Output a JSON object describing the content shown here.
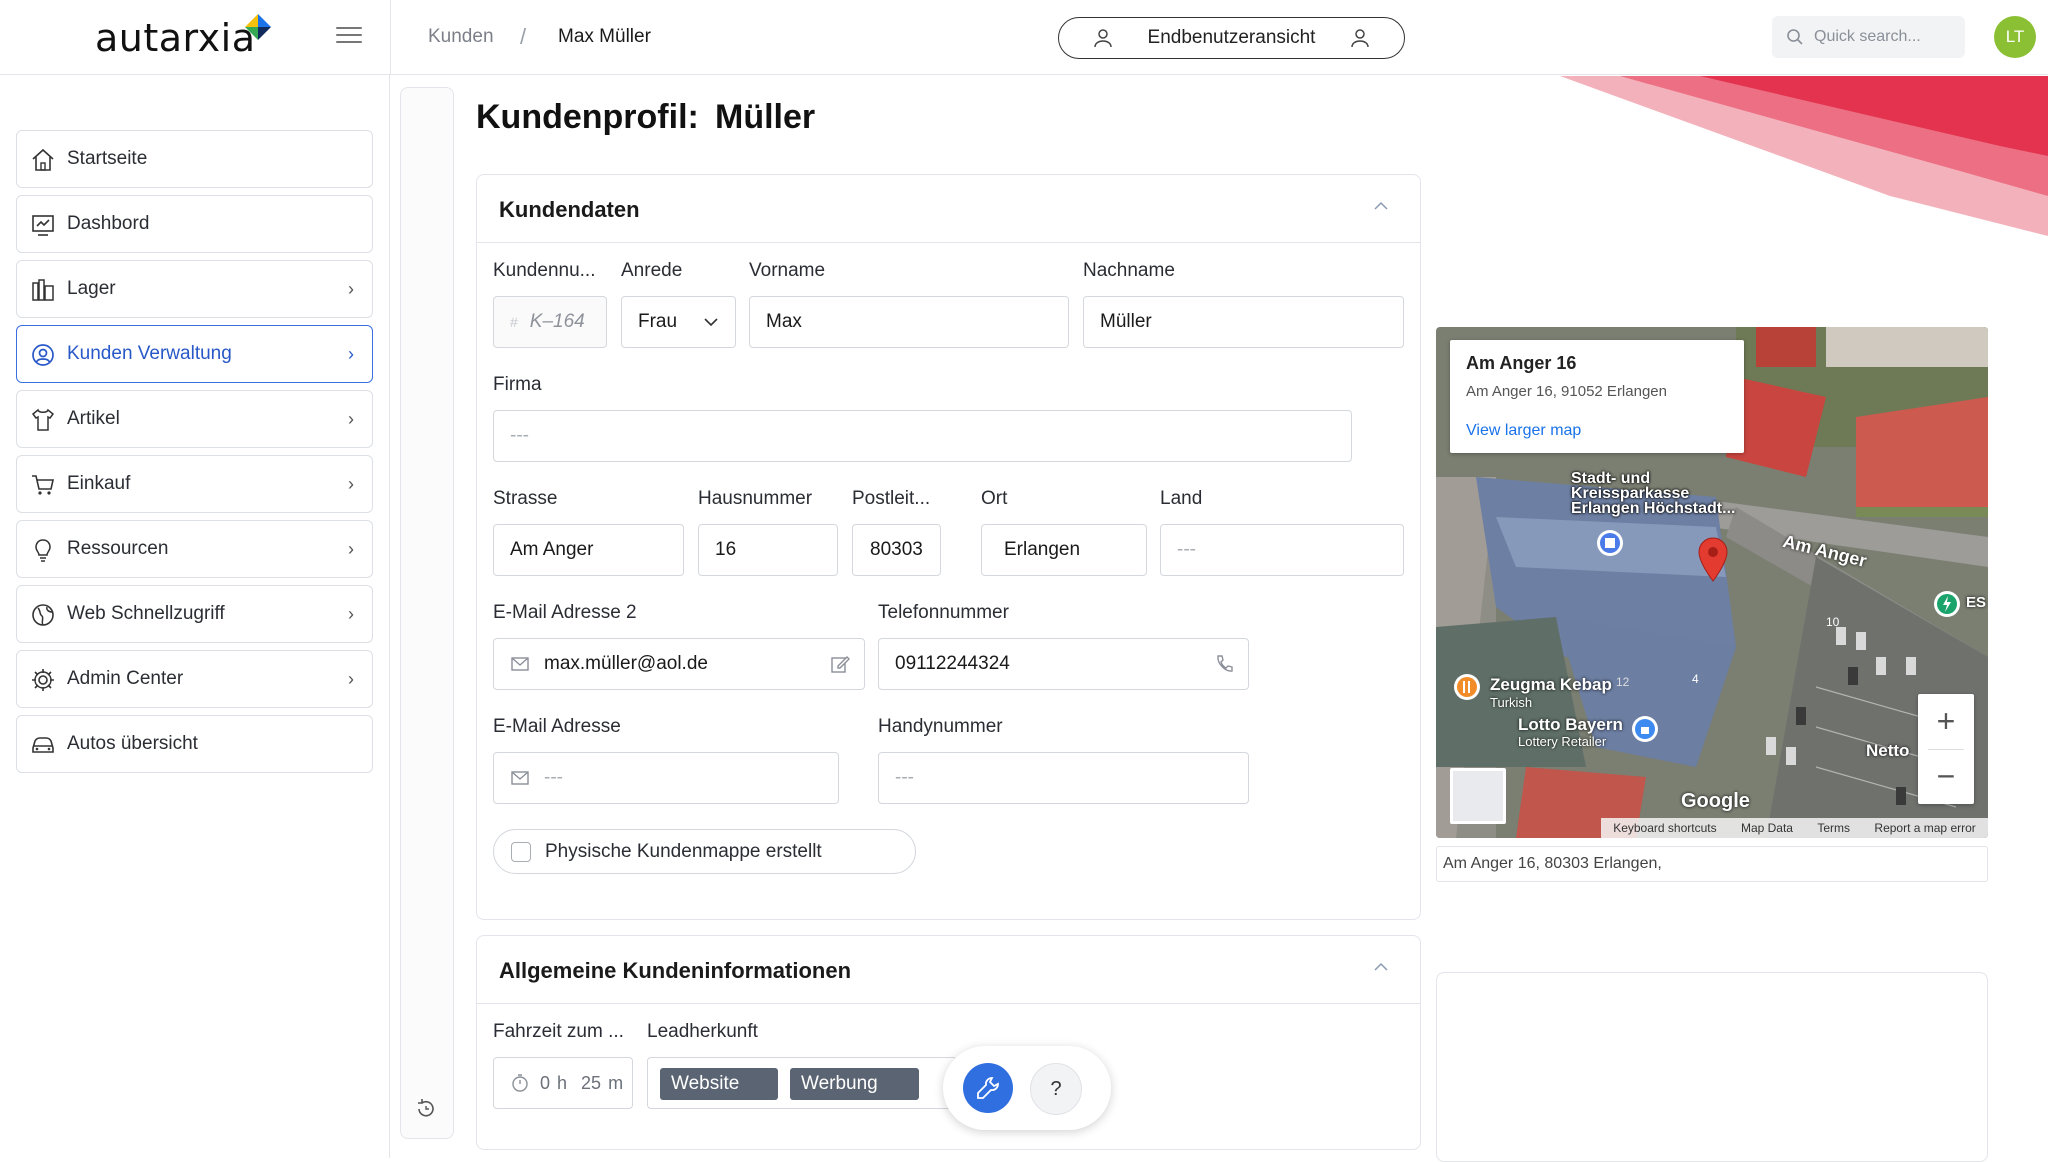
{
  "brand": {
    "name": "autarxia",
    "accent": "#3b6fe0"
  },
  "breadcrumb": {
    "items": [
      "Kunden",
      "Max Müller"
    ],
    "separator": "/"
  },
  "header": {
    "enduser_view_label": "Endbenutzeransicht",
    "search_placeholder": "Quick search...",
    "avatar_initials": "LT"
  },
  "sidebar": {
    "items": [
      {
        "label": "Startseite",
        "icon": "home-icon",
        "chevron": false
      },
      {
        "label": "Dashbord",
        "icon": "dashboard-icon",
        "chevron": false
      },
      {
        "label": "Lager",
        "icon": "warehouse-icon",
        "chevron": true
      },
      {
        "label": "Kunden Verwaltung",
        "icon": "user-circle-icon",
        "chevron": true,
        "active": true
      },
      {
        "label": "Artikel",
        "icon": "shirt-icon",
        "chevron": true
      },
      {
        "label": "Einkauf",
        "icon": "cart-icon",
        "chevron": true
      },
      {
        "label": "Ressourcen",
        "icon": "lightbulb-icon",
        "chevron": true
      },
      {
        "label": "Web Schnellzugriff",
        "icon": "globe-icon",
        "chevron": true
      },
      {
        "label": "Admin Center",
        "icon": "gear-icon",
        "chevron": true
      },
      {
        "label": "Autos übersicht",
        "icon": "car-icon",
        "chevron": false
      }
    ]
  },
  "page": {
    "title": "Kundenprofil:",
    "name": "Müller"
  },
  "kundendaten": {
    "title": "Kundendaten",
    "kundennummer": {
      "label": "Kundennu...",
      "value": "K–164"
    },
    "anrede": {
      "label": "Anrede",
      "value": "Frau"
    },
    "vorname": {
      "label": "Vorname",
      "value": "Max"
    },
    "nachname": {
      "label": "Nachname",
      "value": "Müller"
    },
    "firma": {
      "label": "Firma",
      "placeholder": "---"
    },
    "strasse": {
      "label": "Strasse",
      "value": "Am Anger"
    },
    "hausnummer": {
      "label": "Hausnummer",
      "value": "16"
    },
    "postleitzahl": {
      "label": "Postleit...",
      "value": "80303"
    },
    "ort": {
      "label": "Ort",
      "value": "Erlangen"
    },
    "land": {
      "label": "Land",
      "placeholder": "---"
    },
    "email2": {
      "label": "E-Mail Adresse 2",
      "value": "max.müller@aol.de"
    },
    "telefon": {
      "label": "Telefonnummer",
      "value": "09112244324"
    },
    "email": {
      "label": "E-Mail Adresse",
      "placeholder": "---"
    },
    "handy": {
      "label": "Handynummer",
      "placeholder": "---"
    },
    "mappe_checkbox": {
      "label": "Physische Kundenmappe erstellt",
      "checked": false
    }
  },
  "allgemein": {
    "title": "Allgemeine Kundeninformationen",
    "fahrzeit": {
      "label": "Fahrzeit zum ...",
      "hours": "0",
      "hours_unit": "h",
      "minutes": "25",
      "minutes_unit": "m"
    },
    "leadherkunft": {
      "label": "Leadherkunft",
      "tags": [
        "Website",
        "Werbung"
      ]
    }
  },
  "map": {
    "info_title": "Am Anger 16",
    "info_address": "Am Anger 16, 91052 Erlangen",
    "larger_map_link": "View larger map",
    "labels": {
      "bank": "Stadt- und Kreissparkasse Erlangen Höchstadt...",
      "street": "Am Anger",
      "kebap": "Zeugma Kebap",
      "kebap_sub": "Turkish",
      "lotto": "Lotto Bayern",
      "lotto_sub": "Lottery Retailer",
      "netto": "Netto",
      "google": "Google",
      "es": "ES",
      "num_10": "10",
      "num_4": "4",
      "num_12": "12"
    },
    "footer": [
      "Keyboard shortcuts",
      "Map Data",
      "Terms",
      "Report a map error"
    ],
    "zoom_in": "+",
    "zoom_out": "−",
    "address_line": "Am Anger 16, 80303 Erlangen,"
  },
  "fab": {
    "help_label": "?"
  }
}
